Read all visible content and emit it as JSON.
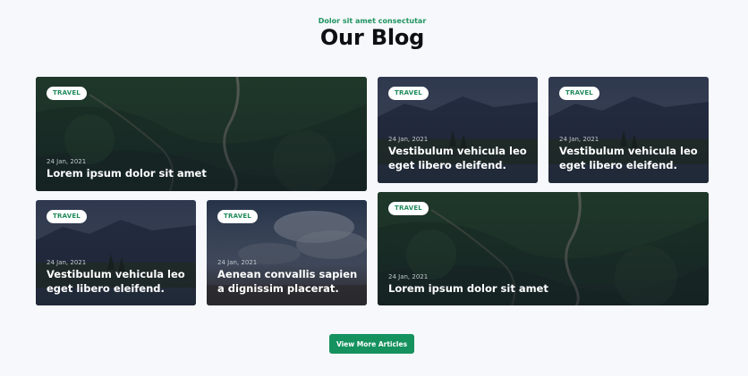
{
  "header": {
    "subtitle": "Dolor sit amet consectutar",
    "title": "Our Blog"
  },
  "posts": [
    {
      "tag": "TRAVEL",
      "date": "24 Jan, 2021",
      "title": "Lorem ipsum dolor sit amet",
      "image": "aerial-forest-road"
    },
    {
      "tag": "TRAVEL",
      "date": "24 Jan, 2021",
      "title": "Vestibulum vehicula leo eget libero eleifend.",
      "image": "mountain-lake"
    },
    {
      "tag": "TRAVEL",
      "date": "24 Jan, 2021",
      "title": "Vestibulum vehicula leo eget libero eleifend.",
      "image": "mountain-lake"
    },
    {
      "tag": "TRAVEL",
      "date": "24 Jan, 2021",
      "title": "Vestibulum vehicula leo eget libero eleifend.",
      "image": "mountain-lake"
    },
    {
      "tag": "TRAVEL",
      "date": "24 Jan, 2021",
      "title": "Aenean convallis sapien a dignissim placerat.",
      "image": "cloudy-sky-road"
    },
    {
      "tag": "TRAVEL",
      "date": "24 Jan, 2021",
      "title": "Lorem ipsum dolor sit amet",
      "image": "aerial-forest-road"
    }
  ],
  "actions": {
    "view_more": "View More Articles"
  },
  "colors": {
    "accent": "#16925f",
    "subtitle": "#1f9460",
    "badge_text": "#1f8a5a",
    "background": "#f6f8fb"
  }
}
